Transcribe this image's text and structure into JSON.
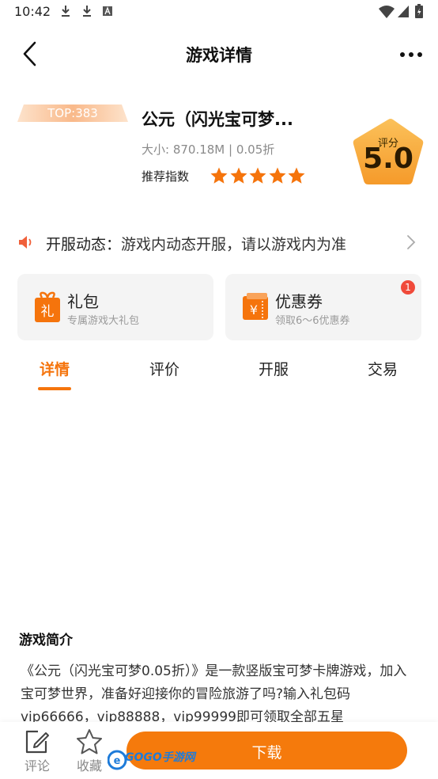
{
  "status_bar": {
    "time": "10:42",
    "icons": [
      "download-icon",
      "download-icon",
      "a-box-icon"
    ],
    "right_icons": [
      "wifi-icon",
      "signal-icon",
      "battery-icon"
    ]
  },
  "nav": {
    "title": "游戏详情",
    "back_icon": "chevron-left-icon",
    "more_icon": "more-dots-icon"
  },
  "game": {
    "rank": "TOP:383",
    "title": "公元（闪光宝可梦...",
    "size_line": "大小: 870.18M | 0.05折",
    "recommend_label": "推荐指数",
    "stars": 5,
    "score_label": "评分",
    "score_value": "5.0"
  },
  "announcement": {
    "head": "开服动态：",
    "text": "游戏内动态开服，请以游戏内为准"
  },
  "cards": {
    "gift": {
      "title": "礼包",
      "subtitle": "专属游戏大礼包",
      "icon_glyph": "礼"
    },
    "coupon": {
      "title": "优惠券",
      "subtitle": "领取6～6优惠券",
      "icon_glyph": "¥",
      "badge": "1"
    }
  },
  "tabs": [
    {
      "label": "详情",
      "active": true
    },
    {
      "label": "评价",
      "active": false
    },
    {
      "label": "开服",
      "active": false
    },
    {
      "label": "交易",
      "active": false
    }
  ],
  "intro": {
    "heading": "游戏简介",
    "body": "《公元（闪光宝可梦0.05折）》是一款竖版宝可梦卡牌游戏，加入宝可梦世界，准备好迎接你的冒险旅游了吗?输入礼包码vip66666，vip88888，vip99999即可领取全部五星"
  },
  "bottom": {
    "comment_label": "评论",
    "favorite_label": "收藏",
    "download_label": "下载",
    "watermark": "GOGO手游网"
  },
  "colors": {
    "accent": "#f5740c",
    "badge_red": "#f04a3a",
    "star": "#f5740c",
    "score_gold": "#f7a93a"
  }
}
